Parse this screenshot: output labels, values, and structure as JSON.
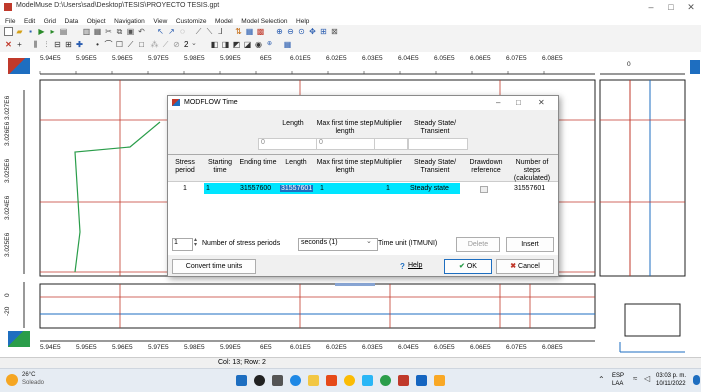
{
  "window": {
    "title": "ModelMuse D:\\Users\\sad\\Desktop\\TESIS\\PROYECTO TESIS.gpt",
    "minimize_icon": "–",
    "maximize_icon": "□",
    "close_icon": "✕"
  },
  "menu": [
    "File",
    "Edit",
    "Grid",
    "Data",
    "Object",
    "Navigation",
    "View",
    "Customize",
    "Model",
    "Model Selection",
    "Help"
  ],
  "toolbar2": {
    "zoom_value": "2"
  },
  "top_axis_labels": [
    "5.94E5",
    "5.95E5",
    "5.96E5",
    "5.97E5",
    "5.98E5",
    "5.99E5",
    "6E5",
    "6.01E5",
    "6.02E5",
    "6.03E5",
    "6.04E5",
    "6.05E5",
    "6.06E5",
    "6.07E5",
    "6.08E5"
  ],
  "bottom_axis_labels": [
    "5.94E5",
    "5.95E5",
    "5.96E5",
    "5.97E5",
    "5.98E5",
    "5.99E5",
    "6E5",
    "6.01E5",
    "6.02E5",
    "6.03E5",
    "6.04E5",
    "6.05E5",
    "6.06E5",
    "6.07E5",
    "6.08E5"
  ],
  "left_axis_labels": [
    "3.025E6",
    "3.024E6",
    "3.025E6",
    "3.026E6",
    "3.027E6"
  ],
  "side_axis_labels": [
    "-20",
    "0"
  ],
  "right_top_label": "0",
  "dialog": {
    "title": "MODFLOW Time",
    "min_icon": "–",
    "max_icon": "□",
    "close_icon": "✕",
    "top_headers": [
      "Length",
      "Max first time step length",
      "Multiplier",
      "Steady State/ Transient"
    ],
    "top_values": [
      "0",
      "0"
    ],
    "columns": [
      "Stress period",
      "Starting time",
      "Ending time",
      "Length",
      "Max first time step length",
      "Multiplier",
      "Steady State/ Transient",
      "Drawdown reference",
      "Number of steps (calculated)"
    ],
    "row": {
      "stress_period": "1",
      "starting_time": "1",
      "ending_time": "31557600",
      "length": "31557601",
      "max_first": "1",
      "multiplier": "1",
      "steady": "Steady state",
      "steps": "31557601"
    },
    "num_periods_value": "1",
    "num_periods_label": "Number of stress periods",
    "time_unit_value": "seconds (1)",
    "time_unit_label": "Time unit (ITMUNI)",
    "delete_label": "Delete",
    "insert_label": "Insert",
    "convert_label": "Convert time units",
    "help_label": "Help",
    "ok_label": "OK",
    "cancel_label": "Cancel"
  },
  "status": {
    "position": "Col: 13; Row: 2"
  },
  "taskbar": {
    "weather_temp": "26°C",
    "weather_text": "Soleado",
    "lang": "ESP",
    "lang2": "LAA",
    "time": "03:03 p. m.",
    "date": "10/11/2022"
  }
}
